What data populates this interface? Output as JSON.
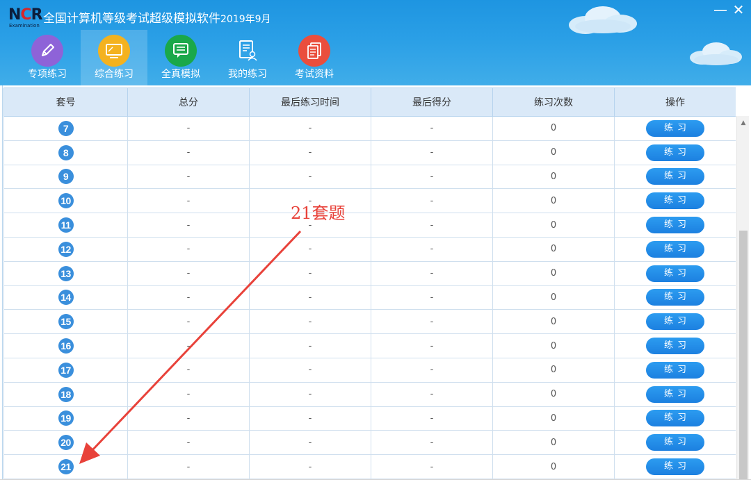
{
  "window": {
    "title": "全国计算机等级考试超级模拟软件",
    "version": "2019年9月",
    "minimize_symbol": "—",
    "close_symbol": "✕",
    "logo_text": "NCR",
    "logo_subtext": "Examination"
  },
  "nav": [
    {
      "label": "专项练习",
      "icon": "pencil-icon",
      "color": "#8e63d8"
    },
    {
      "label": "综合练习",
      "icon": "monitor-icon",
      "color": "#f4b21f"
    },
    {
      "label": "全真模拟",
      "icon": "chat-bubble-icon",
      "color": "#1aa84a"
    },
    {
      "label": "我的练习",
      "icon": "document-user-icon",
      "color": "#2aa0f0"
    },
    {
      "label": "考试资料",
      "icon": "documents-icon",
      "color": "#ea4e3d"
    }
  ],
  "active_nav": "综合练习",
  "table": {
    "headers": [
      "套号",
      "总分",
      "最后练习时间",
      "最后得分",
      "练习次数",
      "操作"
    ],
    "rows": [
      {
        "num": "7",
        "total": "-",
        "last_time": "-",
        "last_score": "-",
        "count": "0",
        "action": "练习"
      },
      {
        "num": "8",
        "total": "-",
        "last_time": "-",
        "last_score": "-",
        "count": "0",
        "action": "练习"
      },
      {
        "num": "9",
        "total": "-",
        "last_time": "-",
        "last_score": "-",
        "count": "0",
        "action": "练习"
      },
      {
        "num": "10",
        "total": "-",
        "last_time": "-",
        "last_score": "-",
        "count": "0",
        "action": "练习"
      },
      {
        "num": "11",
        "total": "-",
        "last_time": "-",
        "last_score": "-",
        "count": "0",
        "action": "练习"
      },
      {
        "num": "12",
        "total": "-",
        "last_time": "-",
        "last_score": "-",
        "count": "0",
        "action": "练习"
      },
      {
        "num": "13",
        "total": "-",
        "last_time": "-",
        "last_score": "-",
        "count": "0",
        "action": "练习"
      },
      {
        "num": "14",
        "total": "-",
        "last_time": "-",
        "last_score": "-",
        "count": "0",
        "action": "练习"
      },
      {
        "num": "15",
        "total": "-",
        "last_time": "-",
        "last_score": "-",
        "count": "0",
        "action": "练习"
      },
      {
        "num": "16",
        "total": "-",
        "last_time": "-",
        "last_score": "-",
        "count": "0",
        "action": "练习"
      },
      {
        "num": "17",
        "total": "-",
        "last_time": "-",
        "last_score": "-",
        "count": "0",
        "action": "练习"
      },
      {
        "num": "18",
        "total": "-",
        "last_time": "-",
        "last_score": "-",
        "count": "0",
        "action": "练习"
      },
      {
        "num": "19",
        "total": "-",
        "last_time": "-",
        "last_score": "-",
        "count": "0",
        "action": "练习"
      },
      {
        "num": "20",
        "total": "-",
        "last_time": "-",
        "last_score": "-",
        "count": "0",
        "action": "练习"
      },
      {
        "num": "21",
        "total": "-",
        "last_time": "-",
        "last_score": "-",
        "count": "0",
        "action": "练习"
      }
    ]
  },
  "annotation": {
    "text": "21套题",
    "color": "#e8423a"
  },
  "colors": {
    "header_blue": "#2a9fe6",
    "table_header_bg": "#dae9f8",
    "badge_blue": "#3a8fdc",
    "button_blue": "#1c80e0"
  }
}
